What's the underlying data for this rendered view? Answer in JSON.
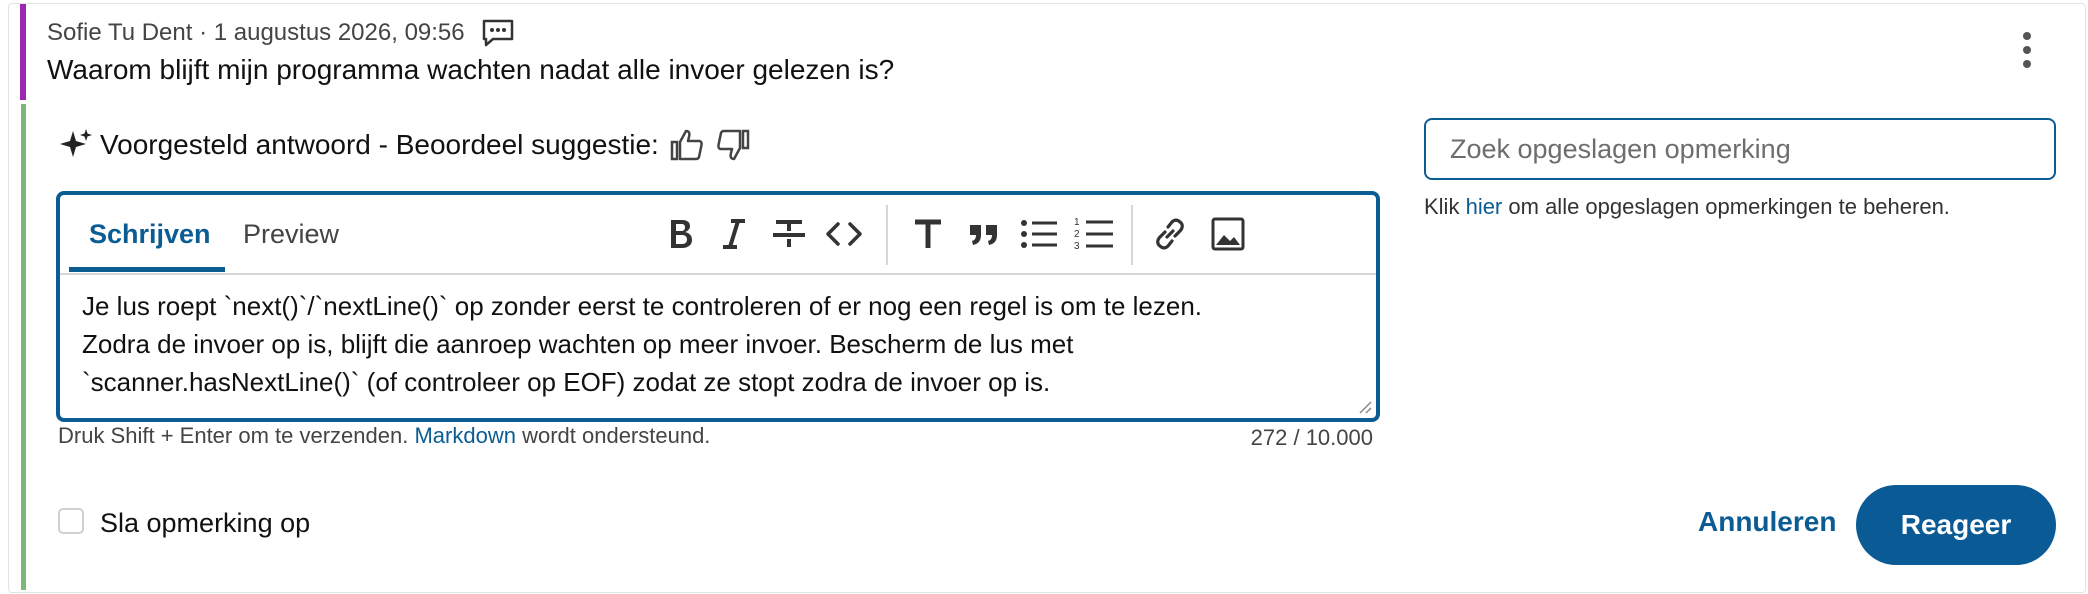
{
  "comment": {
    "author_line": "Sofie Tu Dent · 1 augustus 2026, 09:56",
    "question": "Waarom blijft mijn programma wachten nadat alle invoer gelezen is?"
  },
  "suggestion": {
    "label": "Voorgesteld antwoord - Beoordeel suggestie:"
  },
  "editor": {
    "tabs": {
      "write": "Schrijven",
      "preview": "Preview"
    },
    "tools": [
      "bold-icon",
      "italic-icon",
      "strikethrough-icon",
      "code-icon",
      "heading-icon",
      "quote-icon",
      "bulleted-list-icon",
      "numbered-list-icon",
      "link-icon",
      "image-icon"
    ],
    "text": "Je lus roept `next()`/`nextLine()` op zonder eerst te controleren of er nog een regel is om te lezen.\nZodra de invoer op is, blijft die aanroep wachten op meer invoer. Bescherm de lus met\n`scanner.hasNextLine()` (of controleer op EOF) zodat ze stopt zodra de invoer op is.",
    "hint_before": "Druk Shift + Enter om te verzenden.",
    "hint_link": "Markdown",
    "hint_after": "wordt ondersteund.",
    "counter": "272 / 10.000"
  },
  "saved": {
    "search_placeholder": "Zoek opgeslagen opmerking",
    "manage_before": "Klik",
    "manage_link": "hier",
    "manage_after": "om alle opgeslagen opmerkingen te beheren."
  },
  "actions": {
    "save_comment": "Sla opmerking op",
    "cancel": "Annuleren",
    "submit": "Reageer"
  },
  "colors": {
    "accent": "#0c5c94",
    "comment_bar": "#9c27b0",
    "answer_bar": "#7cb87a"
  }
}
